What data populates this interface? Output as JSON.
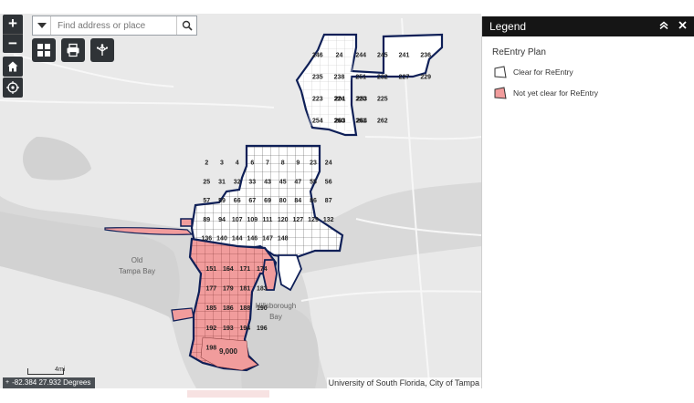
{
  "search": {
    "placeholder": "Find address or place"
  },
  "nav": {
    "zoom_in": "+",
    "zoom_out": "−"
  },
  "legend": {
    "title": "Legend",
    "layer_title": "ReEntry Plan",
    "items": [
      {
        "label": "Clear for ReEntry",
        "fill": "#ffffff",
        "stroke": "#333333"
      },
      {
        "label": "Not yet clear for ReEntry",
        "fill": "#f19c9c",
        "stroke": "#333333"
      }
    ]
  },
  "map": {
    "place_labels": [
      "Old",
      "Tampa Bay",
      "Hillsborough",
      "Bay"
    ],
    "zone_labels": {
      "north": [
        "246",
        "24",
        "244",
        "245",
        "241",
        "236",
        "235",
        "238",
        "251",
        "232",
        "227",
        "229",
        "223",
        "224",
        "220",
        "225",
        "201",
        "253",
        "254",
        "260",
        "261",
        "262",
        "263",
        "264"
      ],
      "central": [
        "2",
        "3",
        "4",
        "6",
        "7",
        "8",
        "9",
        "23",
        "24",
        "25",
        "31",
        "32",
        "33",
        "43",
        "45",
        "47",
        "55",
        "56",
        "57",
        "59",
        "66",
        "67",
        "69",
        "80",
        "84",
        "86",
        "87",
        "89",
        "94",
        "107",
        "109",
        "111",
        "120",
        "127",
        "129",
        "132",
        "136",
        "140",
        "144",
        "146",
        "147",
        "148"
      ],
      "south": [
        "151",
        "164",
        "171",
        "174",
        "177",
        "179",
        "181",
        "183",
        "185",
        "186",
        "188",
        "190",
        "192",
        "193",
        "194",
        "196",
        "198",
        "9,000"
      ]
    },
    "colors": {
      "clear": "#ffffff",
      "not_clear": "#f19c9c",
      "boundary": "#0e1f57",
      "water": "#d9d9d9",
      "land": "#e6e6e6"
    }
  },
  "scale": {
    "label": "4mi"
  },
  "coords": {
    "text": "-82.384 27.932 Degrees"
  },
  "attribution": "University of South Florida, City of Tampa"
}
